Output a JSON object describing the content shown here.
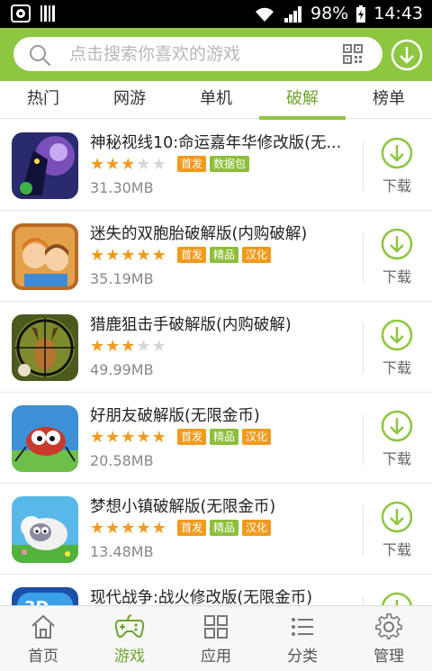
{
  "status_bar": {
    "battery": "98%",
    "time": "14:43"
  },
  "search": {
    "placeholder": "点击搜索你喜欢的游戏"
  },
  "tabs": [
    {
      "label": "热门",
      "active": false
    },
    {
      "label": "网游",
      "active": false
    },
    {
      "label": "单机",
      "active": false
    },
    {
      "label": "破解",
      "active": true
    },
    {
      "label": "榜单",
      "active": false
    }
  ],
  "download_label": "下载",
  "games": [
    {
      "title": "神秘视线10:命运嘉年华修改版(无...",
      "rating": 3,
      "badges": [
        "首发",
        "数据包"
      ],
      "size": "31.30MB"
    },
    {
      "title": "迷失的双胞胎破解版(内购破解)",
      "rating": 5,
      "badges": [
        "首发",
        "精品",
        "汉化"
      ],
      "size": "35.19MB"
    },
    {
      "title": "猎鹿狙击手破解版(内购破解)",
      "rating": 3,
      "badges": [],
      "size": "49.99MB"
    },
    {
      "title": "好朋友破解版(无限金币)",
      "rating": 5,
      "badges": [
        "首发",
        "精品",
        "汉化"
      ],
      "size": "20.58MB"
    },
    {
      "title": "梦想小镇破解版(无限金币)",
      "rating": 5,
      "badges": [
        "首发",
        "精品",
        "汉化"
      ],
      "size": "13.48MB"
    },
    {
      "title": "现代战争:战火修改版(无限金币)",
      "rating": 0,
      "badges": [],
      "size": ""
    }
  ],
  "bottom_nav": [
    {
      "label": "首页",
      "icon": "home-icon",
      "active": false
    },
    {
      "label": "游戏",
      "icon": "gamepad-icon",
      "active": true
    },
    {
      "label": "应用",
      "icon": "apps-grid-icon",
      "active": false
    },
    {
      "label": "分类",
      "icon": "list-icon",
      "active": false
    },
    {
      "label": "管理",
      "icon": "gear-icon",
      "active": false
    }
  ],
  "colors": {
    "brand": "#8dc63f",
    "star": "#f39a1e",
    "badge_orange": "#f39a1e",
    "badge_green": "#8dbf3a"
  }
}
